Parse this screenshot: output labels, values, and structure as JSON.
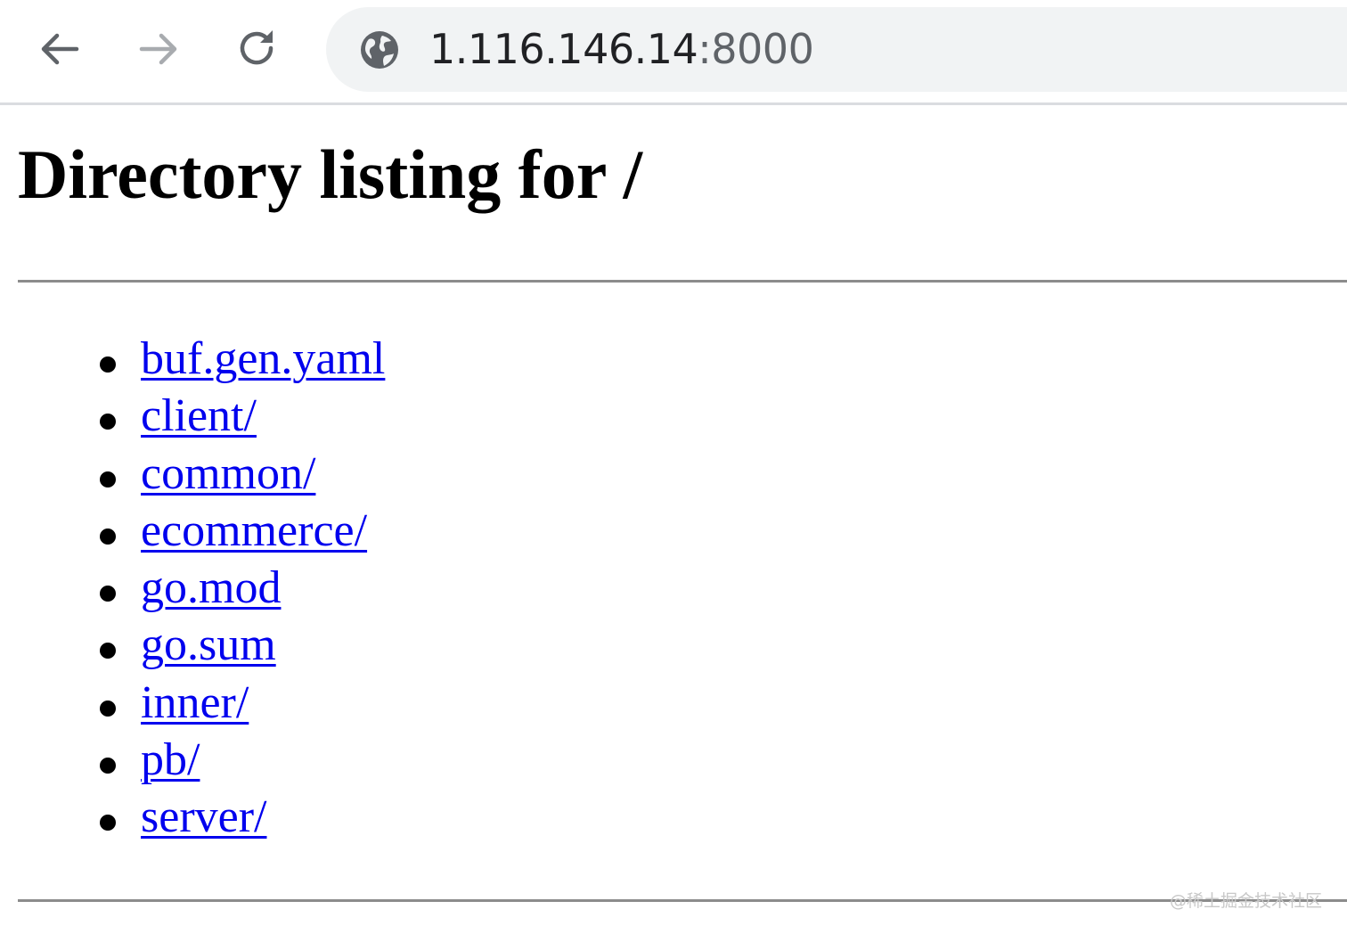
{
  "browser": {
    "url_host": "1.116.146.14",
    "url_port": ":8000",
    "icons": {
      "back": "arrow-left-icon",
      "forward": "arrow-right-icon",
      "reload": "reload-icon",
      "site_info": "globe-icon"
    },
    "colors": {
      "toolbar_icon": "#5f6368",
      "toolbar_icon_disabled": "#a8abaf",
      "omnibox_bg": "#f1f3f4"
    }
  },
  "page": {
    "title": "Directory listing for /",
    "entries": [
      {
        "label": "buf.gen.yaml"
      },
      {
        "label": "client/"
      },
      {
        "label": "common/"
      },
      {
        "label": "ecommerce/"
      },
      {
        "label": "go.mod"
      },
      {
        "label": "go.sum"
      },
      {
        "label": "inner/"
      },
      {
        "label": "pb/"
      },
      {
        "label": "server/"
      }
    ],
    "colors": {
      "link": "#0000ee",
      "rule": "#8c8c8c"
    }
  },
  "watermark": "@稀土掘金技术社区"
}
